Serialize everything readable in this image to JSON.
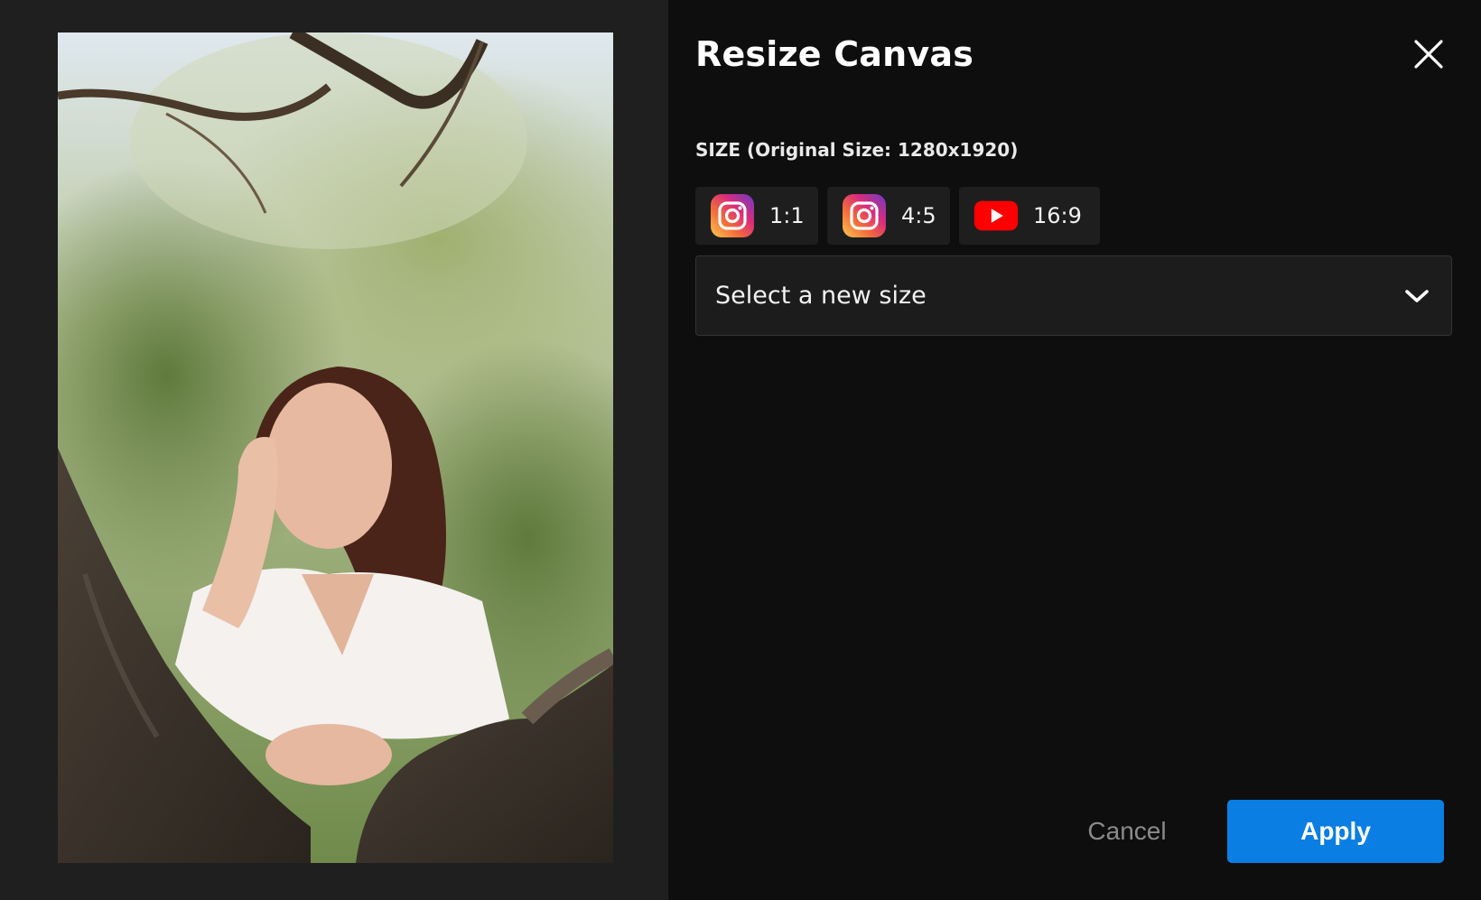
{
  "dialog": {
    "title": "Resize Canvas",
    "close_icon": "close-icon"
  },
  "size_section": {
    "label": "SIZE (Original Size: 1280x1920)",
    "presets": [
      {
        "icon": "instagram-icon",
        "label": "1:1"
      },
      {
        "icon": "instagram-icon",
        "label": "4:5"
      },
      {
        "icon": "youtube-icon",
        "label": "16:9"
      }
    ],
    "select": {
      "value": "Select a new size",
      "icon": "chevron-down-icon"
    }
  },
  "actions": {
    "cancel_label": "Cancel",
    "apply_label": "Apply"
  },
  "preview": {
    "image": "preview-photo"
  },
  "colors": {
    "accent": "#0a7ee3",
    "background": "#0e0e0e",
    "preview_background": "#1f1f1f",
    "youtube_red": "#ff0000"
  }
}
